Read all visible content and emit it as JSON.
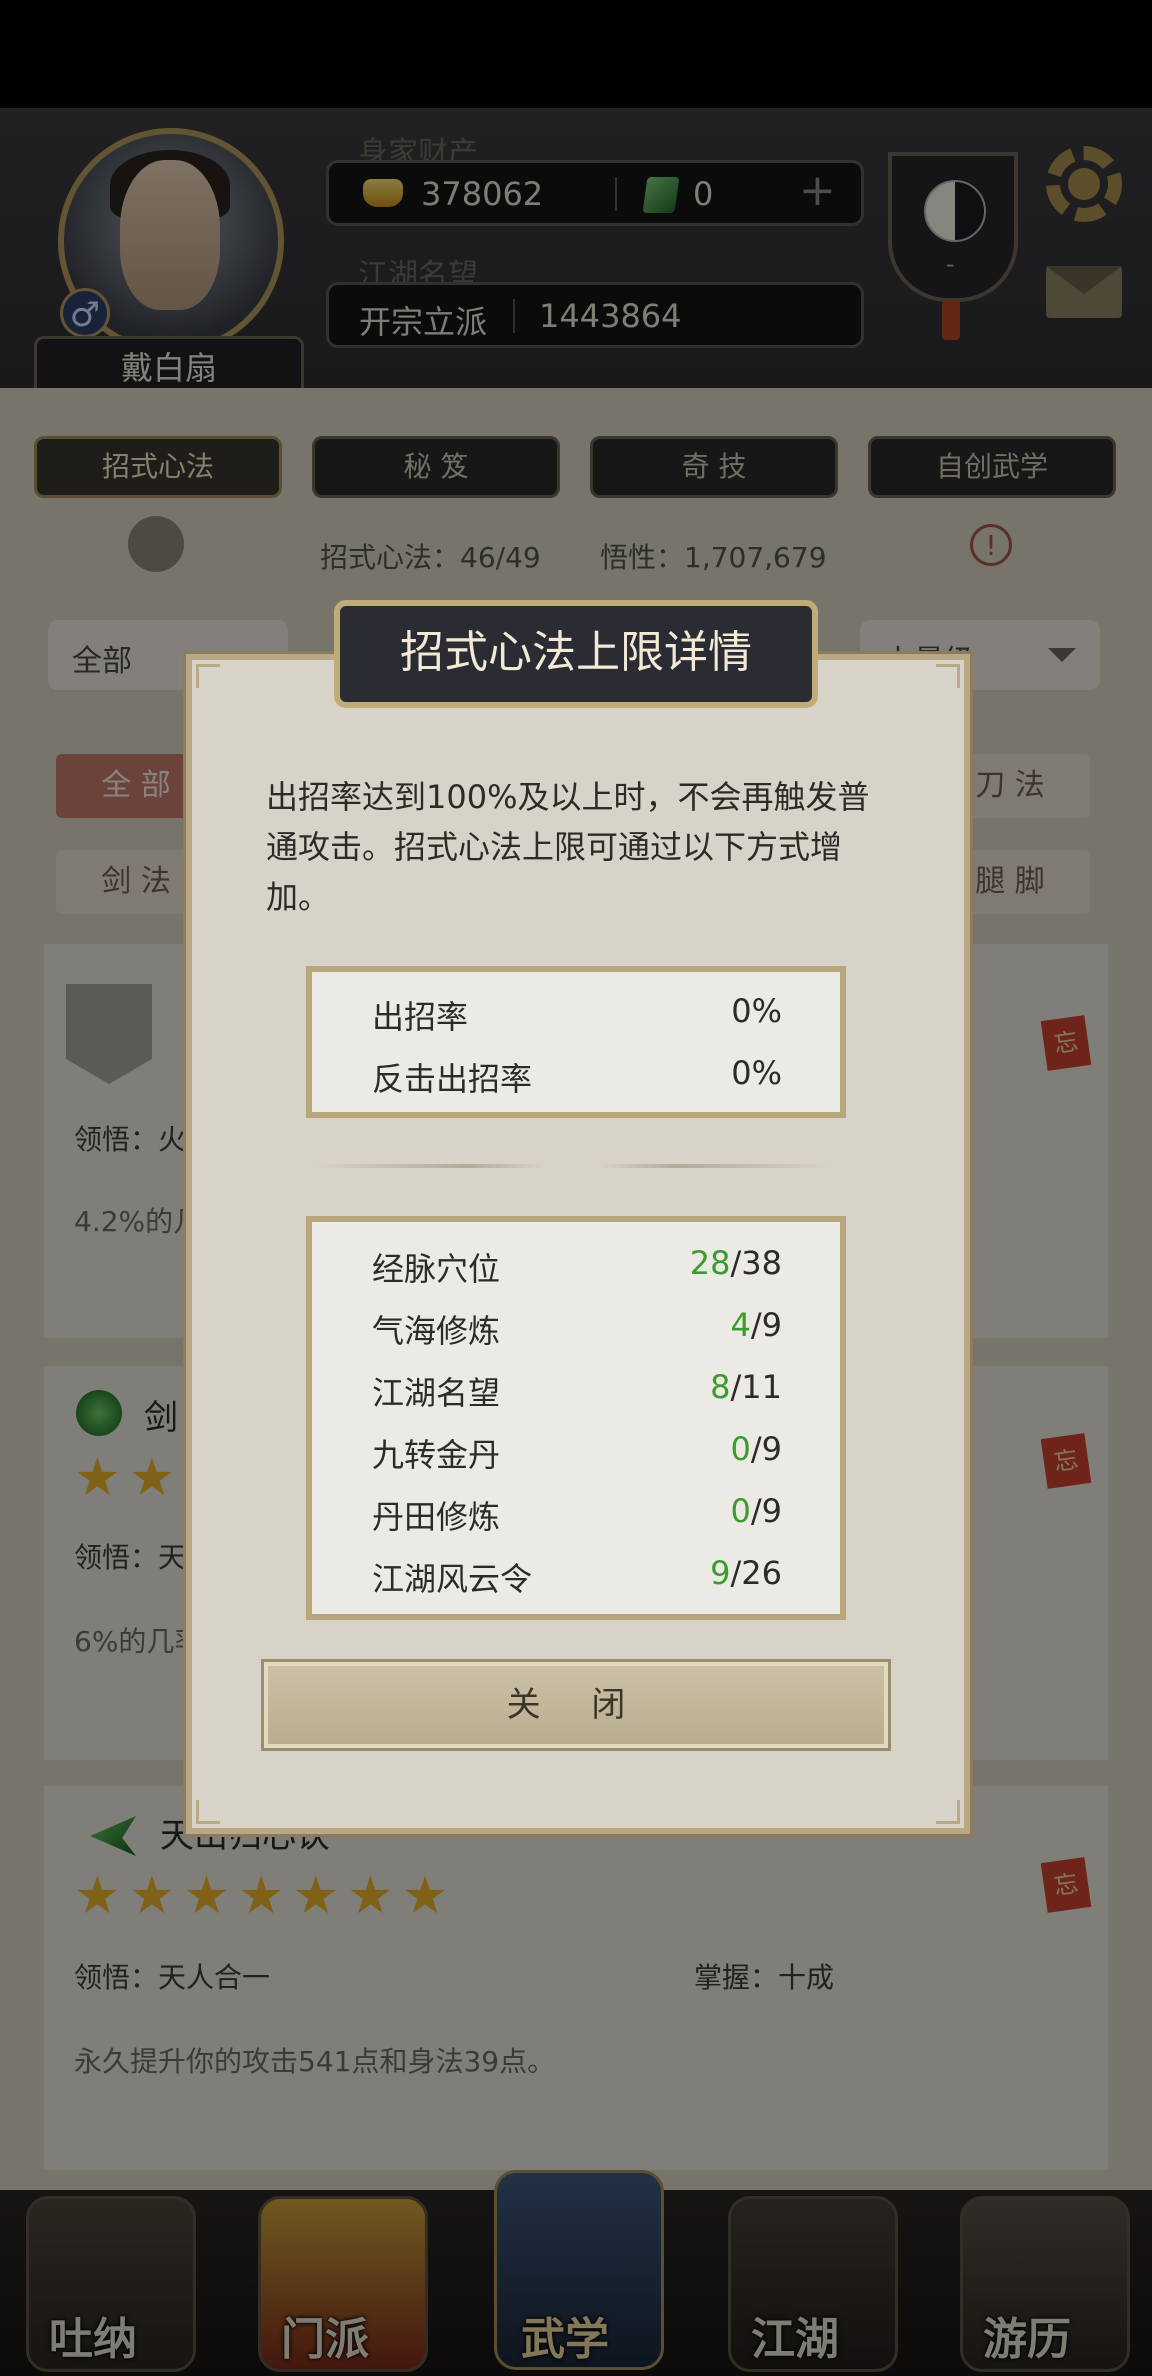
{
  "header": {
    "player_name": "戴白扇",
    "gender_symbol": "♂",
    "wealth_label": "身家财产",
    "gold": "378062",
    "jade": "0",
    "add_symbol": "+",
    "fame_label": "江湖名望",
    "fame_title": "开宗立派",
    "fame_value": "1443864",
    "taiji_sub": "-"
  },
  "tabs": [
    "招式心法",
    "秘 笈",
    "奇 技",
    "自创武学"
  ],
  "summary": {
    "skills": "招式心法：46/49",
    "insight": "悟性：1,707,679",
    "warn_symbol": "!"
  },
  "filters": {
    "left_select": "全部",
    "right_select": "上最级",
    "row1_left": "全 部",
    "row1_right": "刀 法",
    "row2_left": "剑 法",
    "row2_right": "腿 脚"
  },
  "cards": [
    {
      "enlighten": "领悟：火",
      "desc": "4.2%的几",
      "tag": "忘"
    },
    {
      "name": "剑",
      "enlighten": "领悟：天",
      "desc": "6%的几率",
      "tag": "忘",
      "stars": "★★"
    },
    {
      "name": "天山归心诀",
      "stars": "★★★★★★★",
      "enlighten": "领悟：天人合一",
      "mastery": "掌握：十成",
      "desc": "永久提升你的攻击541点和身法39点。",
      "tag": "忘"
    }
  ],
  "dialog": {
    "title": "招式心法上限详情",
    "description": "出招率达到100%及以上时，不会再触发普通攻击。招式心法上限可通过以下方式增加。",
    "rates": [
      {
        "label": "出招率",
        "value": "0%"
      },
      {
        "label": "反击出招率",
        "value": "0%"
      }
    ],
    "limits": [
      {
        "label": "经脉穴位",
        "current": "28",
        "max": "/38"
      },
      {
        "label": "气海修炼",
        "current": "4",
        "max": "/9"
      },
      {
        "label": "江湖名望",
        "current": "8",
        "max": "/11"
      },
      {
        "label": "九转金丹",
        "current": "0",
        "max": "/9"
      },
      {
        "label": "丹田修炼",
        "current": "0",
        "max": "/9"
      },
      {
        "label": "江湖风云令",
        "current": "9",
        "max": "/26"
      }
    ],
    "close_label": "关 闭"
  },
  "nav": [
    "吐纳",
    "门派",
    "武学",
    "江湖",
    "游历"
  ],
  "colors": {
    "accent_gold": "#c0ac77",
    "green_value": "#3a9c2c"
  }
}
